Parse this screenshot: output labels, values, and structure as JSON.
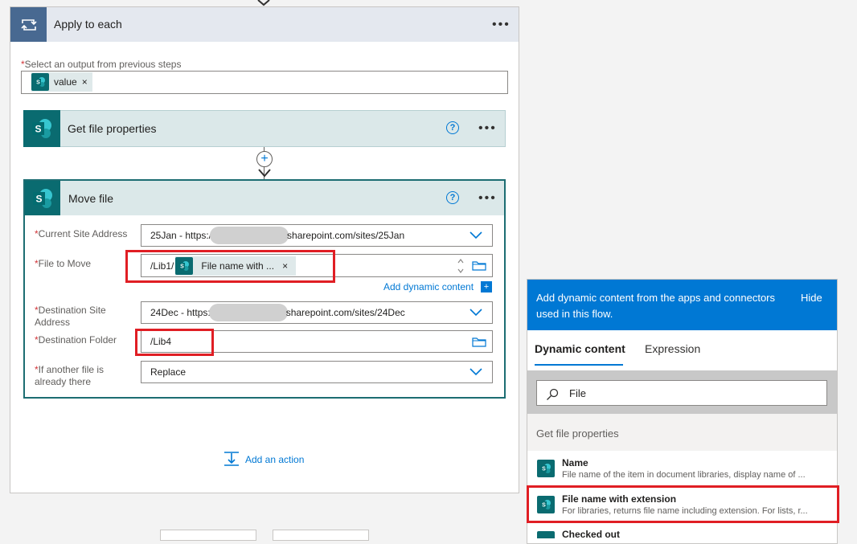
{
  "apply_to_each": {
    "title": "Apply to each",
    "more": "•••",
    "output_label_req": "*",
    "output_label": "Select an output from previous steps",
    "value_token": "value",
    "token_close": "×"
  },
  "get_file_properties": {
    "title": "Get file properties",
    "help": "?",
    "more": "•••"
  },
  "connector": {
    "plus": "+"
  },
  "move_file": {
    "title": "Move file",
    "help": "?",
    "more": "•••",
    "req": "*",
    "fields": {
      "current_site": {
        "label": "Current Site Address",
        "value_prefix": "25Jan - https:/",
        "value_suffix": "sharepoint.com/sites/25Jan"
      },
      "file_to_move": {
        "label": "File to Move",
        "prefix": "/Lib1/",
        "token": "File name with ...",
        "token_close": "×"
      },
      "destination_site": {
        "label": "Destination Site Address",
        "value_prefix": "24Dec - https:",
        "value_suffix": "sharepoint.com/sites/24Dec"
      },
      "destination_folder": {
        "label": "Destination Folder",
        "value": "/Lib4"
      },
      "if_another_file": {
        "label": "If another file is already there",
        "value": "Replace"
      }
    },
    "add_dynamic_content": "Add dynamic content",
    "add_dynamic_plus": "+"
  },
  "add_action": {
    "label": "Add an action"
  },
  "dynamic_panel": {
    "header_text": "Add dynamic content from the apps and connectors used in this flow.",
    "hide": "Hide",
    "tabs": [
      {
        "label": "Dynamic content"
      },
      {
        "label": "Expression"
      }
    ],
    "search_value": "File",
    "group_label": "Get file properties",
    "items": [
      {
        "title": "Name",
        "desc": "File name of the item in document libraries, display name of ..."
      },
      {
        "title": "File name with extension",
        "desc": "For libraries, returns file name including extension. For lists, r..."
      },
      {
        "title": "Checked out",
        "desc": ""
      }
    ]
  },
  "colors": {
    "sharepoint": "#0a6b70",
    "accent": "#0078d4",
    "highlight": "#e01e24",
    "apply_each_icon_bg": "#486991"
  }
}
